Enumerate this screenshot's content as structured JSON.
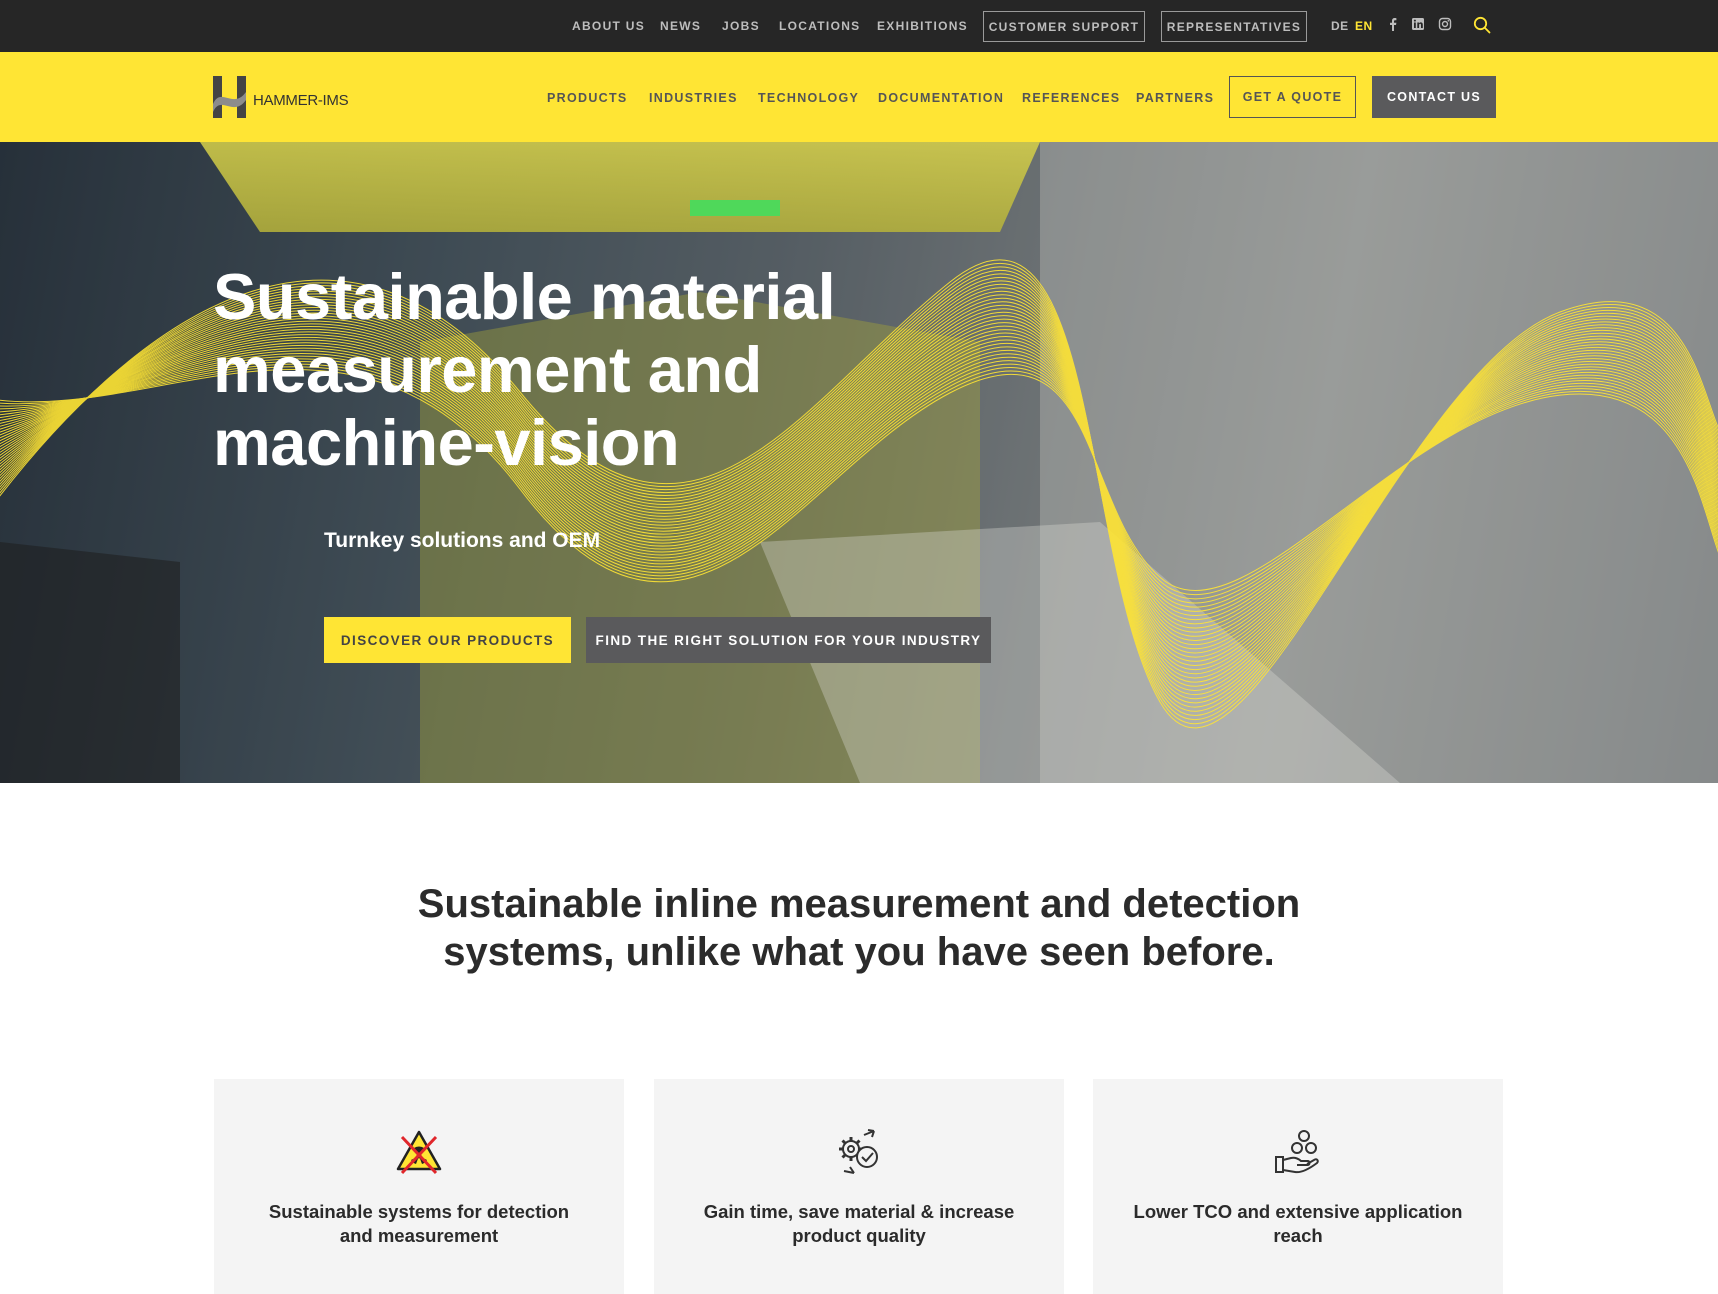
{
  "topbar": {
    "links": [
      "ABOUT US",
      "NEWS",
      "JOBS",
      "LOCATIONS",
      "EXHIBITIONS"
    ],
    "support_label": "CUSTOMER SUPPORT",
    "representatives_label": "REPRESENTATIVES",
    "lang_de": "DE",
    "lang_en": "EN",
    "social_icons": [
      "facebook-icon",
      "linkedin-icon",
      "instagram-icon"
    ],
    "search_icon": "search-icon"
  },
  "header": {
    "logo_text": "HAMMER-IMS",
    "nav": [
      "PRODUCTS",
      "INDUSTRIES",
      "TECHNOLOGY",
      "DOCUMENTATION",
      "REFERENCES",
      "PARTNERS"
    ],
    "quote_label": "GET A QUOTE",
    "contact_label": "CONTACT US"
  },
  "hero": {
    "title": "Sustainable material measurement and machine-vision",
    "subtitle": "Turnkey solutions and OEM",
    "primary_cta": "DISCOVER OUR PRODUCTS",
    "secondary_cta": "FIND THE RIGHT SOLUTION FOR YOUR INDUSTRY"
  },
  "intro": {
    "heading": "Sustainable inline measurement and detection systems, unlike what you have seen before."
  },
  "features": [
    {
      "icon": "no-radiation-icon",
      "label": "Sustainable systems for detection and measurement"
    },
    {
      "icon": "gear-check-icon",
      "label": "Gain time, save material & increase product quality"
    },
    {
      "icon": "hand-coins-icon",
      "label": "Lower TCO and extensive application reach"
    }
  ],
  "colors": {
    "brand_yellow": "#ffe534",
    "dark_bar": "#262626",
    "button_grey": "#5a5a5c",
    "lang_active": "#ffe534"
  }
}
